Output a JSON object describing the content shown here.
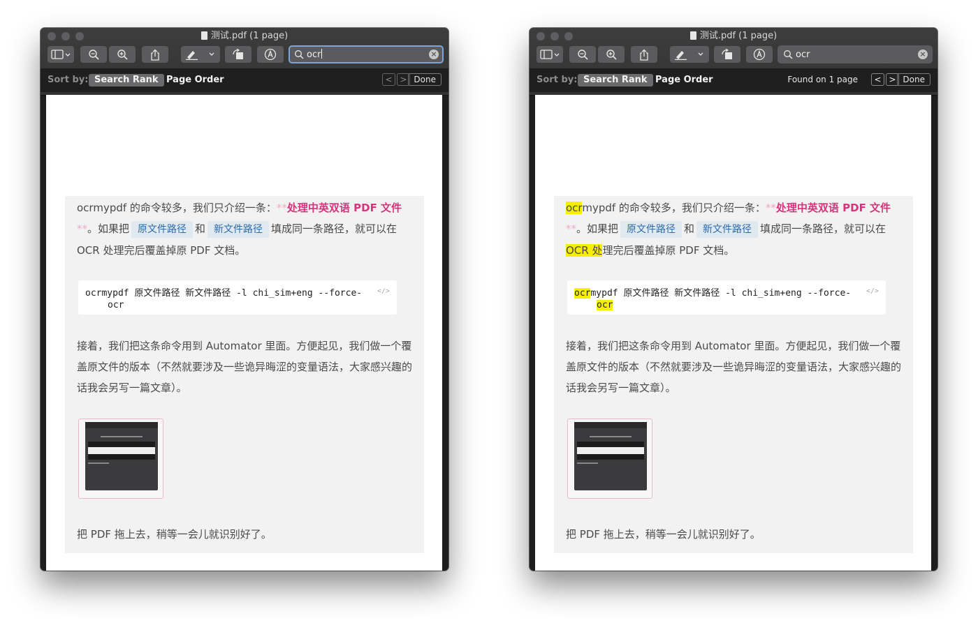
{
  "windows": [
    {
      "id": "left",
      "title": "测试.pdf (1 page)",
      "search": {
        "value": "ocr",
        "focused": true
      },
      "findbar": {
        "sort_by": "Sort by:",
        "search_rank": "Search Rank",
        "page_order": "Page Order",
        "found": "",
        "prev": "<",
        "next": ">",
        "done": "Done"
      },
      "highlights": false
    },
    {
      "id": "right",
      "title": "测试.pdf (1 page)",
      "search": {
        "value": "ocr",
        "focused": false
      },
      "findbar": {
        "sort_by": "Sort by:",
        "search_rank": "Search Rank",
        "page_order": "Page Order",
        "found": "Found on 1 page",
        "prev": "<",
        "next": ">",
        "done": "Done"
      },
      "highlights": true
    }
  ],
  "document": {
    "para1": {
      "ocr": "ocr",
      "a": "mypdf 的命令较多，我们只介绍一条：",
      "stars_open": "**",
      "emphasis": "处理中英双语 PDF 文件",
      "stars_close": "**",
      "b": "。如果把",
      "code1": "原文件路径",
      "c": "和",
      "code2": "新文件路径",
      "d": "填成同一条路径，就可以在 ",
      "ocr_upper": "OCR",
      "e_first": " 处",
      "e_rest": "理完后覆盖掉原 PDF 文档。"
    },
    "codeblock": {
      "ocr": "ocr",
      "line1_rest": "mypdf 原文件路径 新文件路径 -l chi_sim+eng --force-",
      "line2": "ocr",
      "icon": "</>"
    },
    "para2": "接着，我们把这条命令用到 Automator 里面。方便起见，我们做一个覆盖原文件的版本（不然就要涉及一些诡异晦涩的变量语法，大家感兴趣的话我会另写一篇文章）。",
    "para3": "把 PDF 拖上去，稍等一会儿就识别好了。"
  },
  "colors": {
    "highlight": "#f8ee00",
    "emphasis": "#d6347c",
    "inline_code_text": "#2d6aa8",
    "inline_code_bg": "#e1e9f0",
    "search_focus_ring": "#7da4d8"
  }
}
